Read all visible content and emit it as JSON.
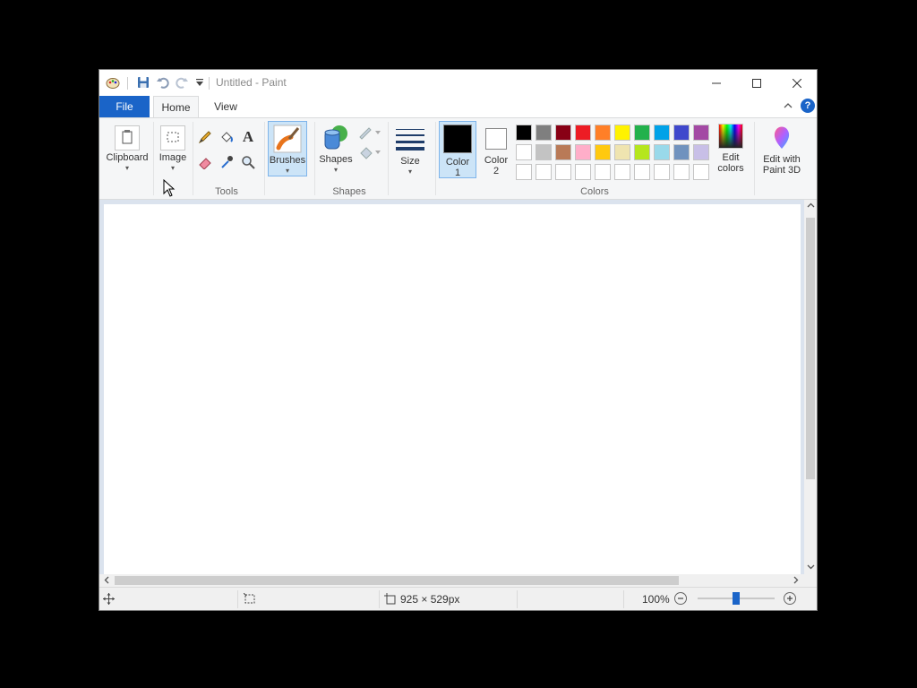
{
  "window": {
    "title": "Untitled - Paint",
    "controls": [
      "minimize",
      "maximize",
      "close"
    ]
  },
  "quick_access": [
    "paint-app-icon",
    "save-icon",
    "undo-icon",
    "redo-icon",
    "customize-dropdown-icon"
  ],
  "tabs": {
    "file": "File",
    "home": "Home",
    "view": "View",
    "active": "Home"
  },
  "ribbon": {
    "clipboard": {
      "label": "Clipboard"
    },
    "image": {
      "label": "Image"
    },
    "tools": {
      "group_label": "Tools",
      "items": [
        "pencil-icon",
        "fill-bucket-icon",
        "text-icon",
        "eraser-icon",
        "color-picker-icon",
        "magnifier-icon"
      ]
    },
    "brushes": {
      "label": "Brushes",
      "selected": true
    },
    "shapes": {
      "label": "Shapes",
      "group_label": "Shapes"
    },
    "size": {
      "label": "Size"
    },
    "color1": {
      "line1": "Color",
      "line2": "1",
      "value": "#000000"
    },
    "color2": {
      "line1": "Color",
      "line2": "2",
      "value": "#ffffff"
    },
    "colors": {
      "group_label": "Colors",
      "row1": [
        "#000000",
        "#7f7f7f",
        "#880015",
        "#ed1c24",
        "#ff7f27",
        "#fff200",
        "#22b14c",
        "#00a2e8",
        "#3f48cc",
        "#a349a4"
      ],
      "row2": [
        "#ffffff",
        "#c3c3c3",
        "#b97a57",
        "#ffaec9",
        "#ffc90e",
        "#efe4b0",
        "#b5e61d",
        "#99d9ea",
        "#7092be",
        "#c8bfe7"
      ],
      "row3": [
        "#ffffff",
        "#ffffff",
        "#ffffff",
        "#ffffff",
        "#ffffff",
        "#ffffff",
        "#ffffff",
        "#ffffff",
        "#ffffff",
        "#ffffff"
      ]
    },
    "edit_colors": {
      "line1": "Edit",
      "line2": "colors"
    },
    "paint3d": {
      "line1": "Edit with",
      "line2": "Paint 3D"
    }
  },
  "status": {
    "canvas_size": "925 × 529px",
    "zoom": "100%",
    "zoom_fraction": 0.5
  }
}
